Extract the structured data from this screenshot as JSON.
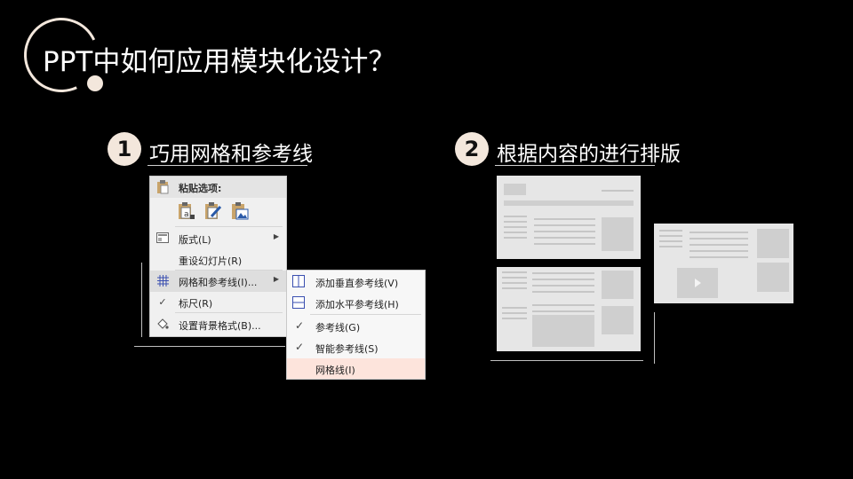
{
  "title": "PPT中如何应用模块化设计？",
  "section1": {
    "number": "1",
    "title": "巧用网格和参考线"
  },
  "section2": {
    "number": "2",
    "title": "根据内容的进行排版"
  },
  "context_menu": {
    "paste_header": "粘贴选项:",
    "paste_options": [
      "paste-keep-source-icon",
      "paste-keep-text-icon",
      "paste-picture-icon"
    ],
    "items": [
      {
        "label": "版式(L)",
        "has_submenu": true
      },
      {
        "label": "重设幻灯片(R)",
        "has_submenu": false
      },
      {
        "label": "网格和参考线(I)...",
        "has_submenu": true
      },
      {
        "label": "标尺(R)",
        "checked": true
      },
      {
        "label": "设置背景格式(B)..."
      }
    ]
  },
  "submenu": {
    "items": [
      {
        "label": "添加垂直参考线(V)"
      },
      {
        "label": "添加水平参考线(H)"
      },
      {
        "label": "参考线(G)",
        "checked": true
      },
      {
        "label": "智能参考线(S)",
        "checked": true
      },
      {
        "label": "网格线(I)",
        "highlighted": true
      }
    ]
  },
  "colors": {
    "background": "#000000",
    "accent": "#f3e7dc",
    "highlight": "#fde4dc"
  }
}
